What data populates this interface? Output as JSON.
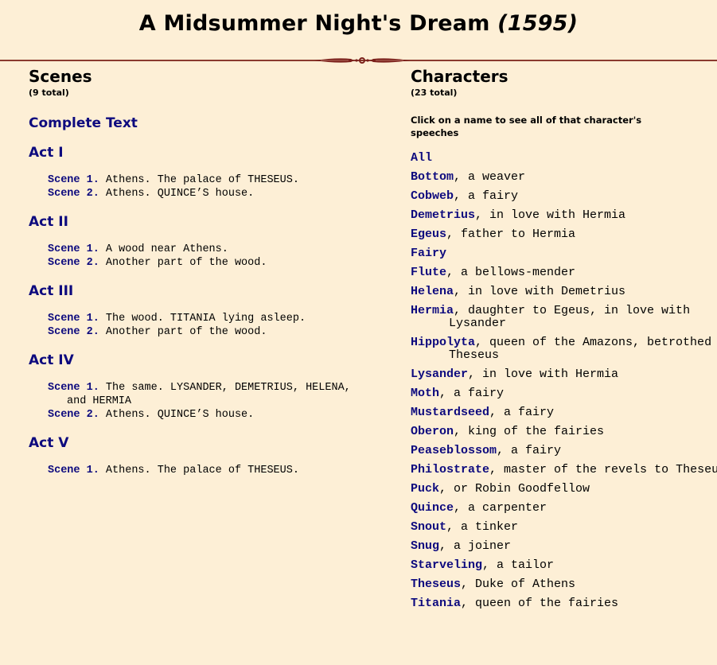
{
  "page": {
    "title": "A Midsummer Night's Dream",
    "year": "(1595)"
  },
  "scenes_section": {
    "heading": "Scenes",
    "total": "(9 total)",
    "complete_text_label": "Complete Text",
    "acts": [
      {
        "label": "Act I",
        "scenes": [
          {
            "label": "Scene 1.",
            "description": "Athens. The palace of THESEUS."
          },
          {
            "label": "Scene 2.",
            "description": "Athens. QUINCE’S house."
          }
        ]
      },
      {
        "label": "Act II",
        "scenes": [
          {
            "label": "Scene 1.",
            "description": "A wood near Athens."
          },
          {
            "label": "Scene 2.",
            "description": "Another part of the wood."
          }
        ]
      },
      {
        "label": "Act III",
        "scenes": [
          {
            "label": "Scene 1.",
            "description": "The wood. TITANIA lying asleep."
          },
          {
            "label": "Scene 2.",
            "description": "Another part of the wood."
          }
        ]
      },
      {
        "label": "Act IV",
        "scenes": [
          {
            "label": "Scene 1.",
            "description": "The same. LYSANDER, DEMETRIUS, HELENA, and HERMIA"
          },
          {
            "label": "Scene 2.",
            "description": "Athens. QUINCE’S house."
          }
        ]
      },
      {
        "label": "Act V",
        "scenes": [
          {
            "label": "Scene 1.",
            "description": "Athens. The palace of THESEUS."
          }
        ]
      }
    ]
  },
  "characters_section": {
    "heading": "Characters",
    "total": "(23 total)",
    "instructions": "Click on a name to see all of that character's speeches",
    "characters": [
      {
        "name": "All",
        "description": ""
      },
      {
        "name": "Bottom",
        "description": ", a weaver"
      },
      {
        "name": "Cobweb",
        "description": ", a fairy"
      },
      {
        "name": "Demetrius",
        "description": ", in love with Hermia"
      },
      {
        "name": "Egeus",
        "description": ", father to Hermia"
      },
      {
        "name": "Fairy",
        "description": ""
      },
      {
        "name": "Flute",
        "description": ", a bellows-mender"
      },
      {
        "name": "Helena",
        "description": ", in love with Demetrius"
      },
      {
        "name": "Hermia",
        "description": ", daughter to Egeus, in love with Lysander"
      },
      {
        "name": "Hippolyta",
        "description": ", queen of the Amazons, betrothed to Theseus"
      },
      {
        "name": "Lysander",
        "description": ", in love with Hermia"
      },
      {
        "name": "Moth",
        "description": ", a fairy"
      },
      {
        "name": "Mustardseed",
        "description": ", a fairy"
      },
      {
        "name": "Oberon",
        "description": ", king of the fairies"
      },
      {
        "name": "Peaseblossom",
        "description": ", a fairy"
      },
      {
        "name": "Philostrate",
        "description": ", master of the revels to Theseus"
      },
      {
        "name": "Puck",
        "description": ", or Robin Goodfellow"
      },
      {
        "name": "Quince",
        "description": ", a carpenter"
      },
      {
        "name": "Snout",
        "description": ", a tinker"
      },
      {
        "name": "Snug",
        "description": ", a joiner"
      },
      {
        "name": "Starveling",
        "description": ", a tailor"
      },
      {
        "name": "Theseus",
        "description": ", Duke of Athens"
      },
      {
        "name": "Titania",
        "description": ", queen of the fairies"
      }
    ]
  },
  "colors": {
    "background": "#fdefd6",
    "link": "#0d0a7e",
    "rule": "#8a3a2e"
  }
}
